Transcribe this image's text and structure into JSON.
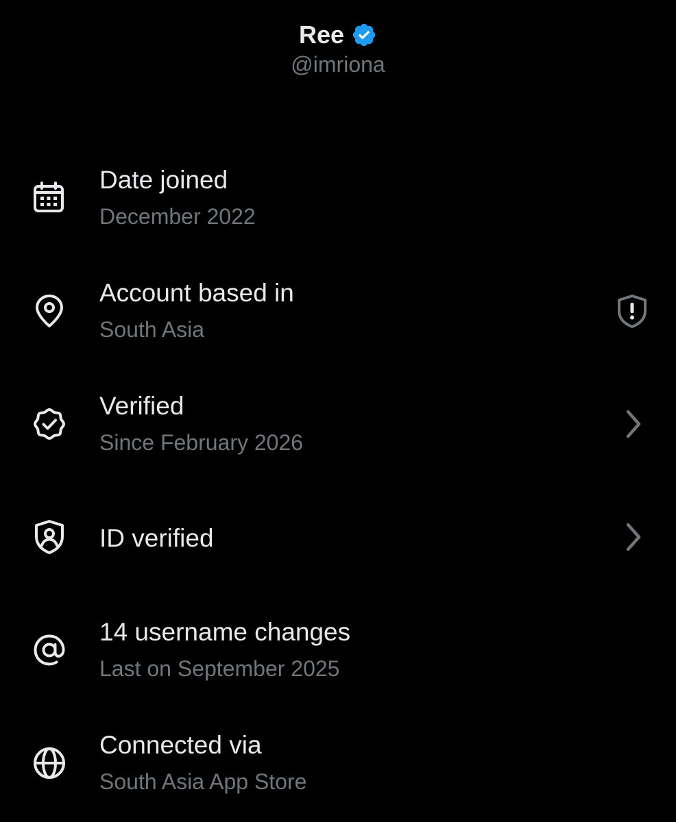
{
  "profile": {
    "display_name": "Ree",
    "handle": "@imriona",
    "badge_icon": "verified-badge-icon",
    "badge_color": "#1d9bf0"
  },
  "colors": {
    "background": "#000000",
    "primary_text": "#e7e9ea",
    "secondary_text": "#71767b"
  },
  "rows": [
    {
      "icon": "calendar-icon",
      "title": "Date joined",
      "subtitle": "December 2022"
    },
    {
      "icon": "location-pin-icon",
      "title": "Account based in",
      "subtitle": "South Asia",
      "trailing_icon": "shield-alert-icon"
    },
    {
      "icon": "verified-seal-icon",
      "title": "Verified",
      "subtitle": "Since February 2026",
      "trailing_icon": "chevron-right-icon"
    },
    {
      "icon": "id-shield-icon",
      "title": "ID verified",
      "trailing_icon": "chevron-right-icon"
    },
    {
      "icon": "at-sign-icon",
      "title": "14 username changes",
      "subtitle": "Last on September 2025"
    },
    {
      "icon": "globe-icon",
      "title": "Connected via",
      "subtitle": "South Asia App Store"
    }
  ]
}
